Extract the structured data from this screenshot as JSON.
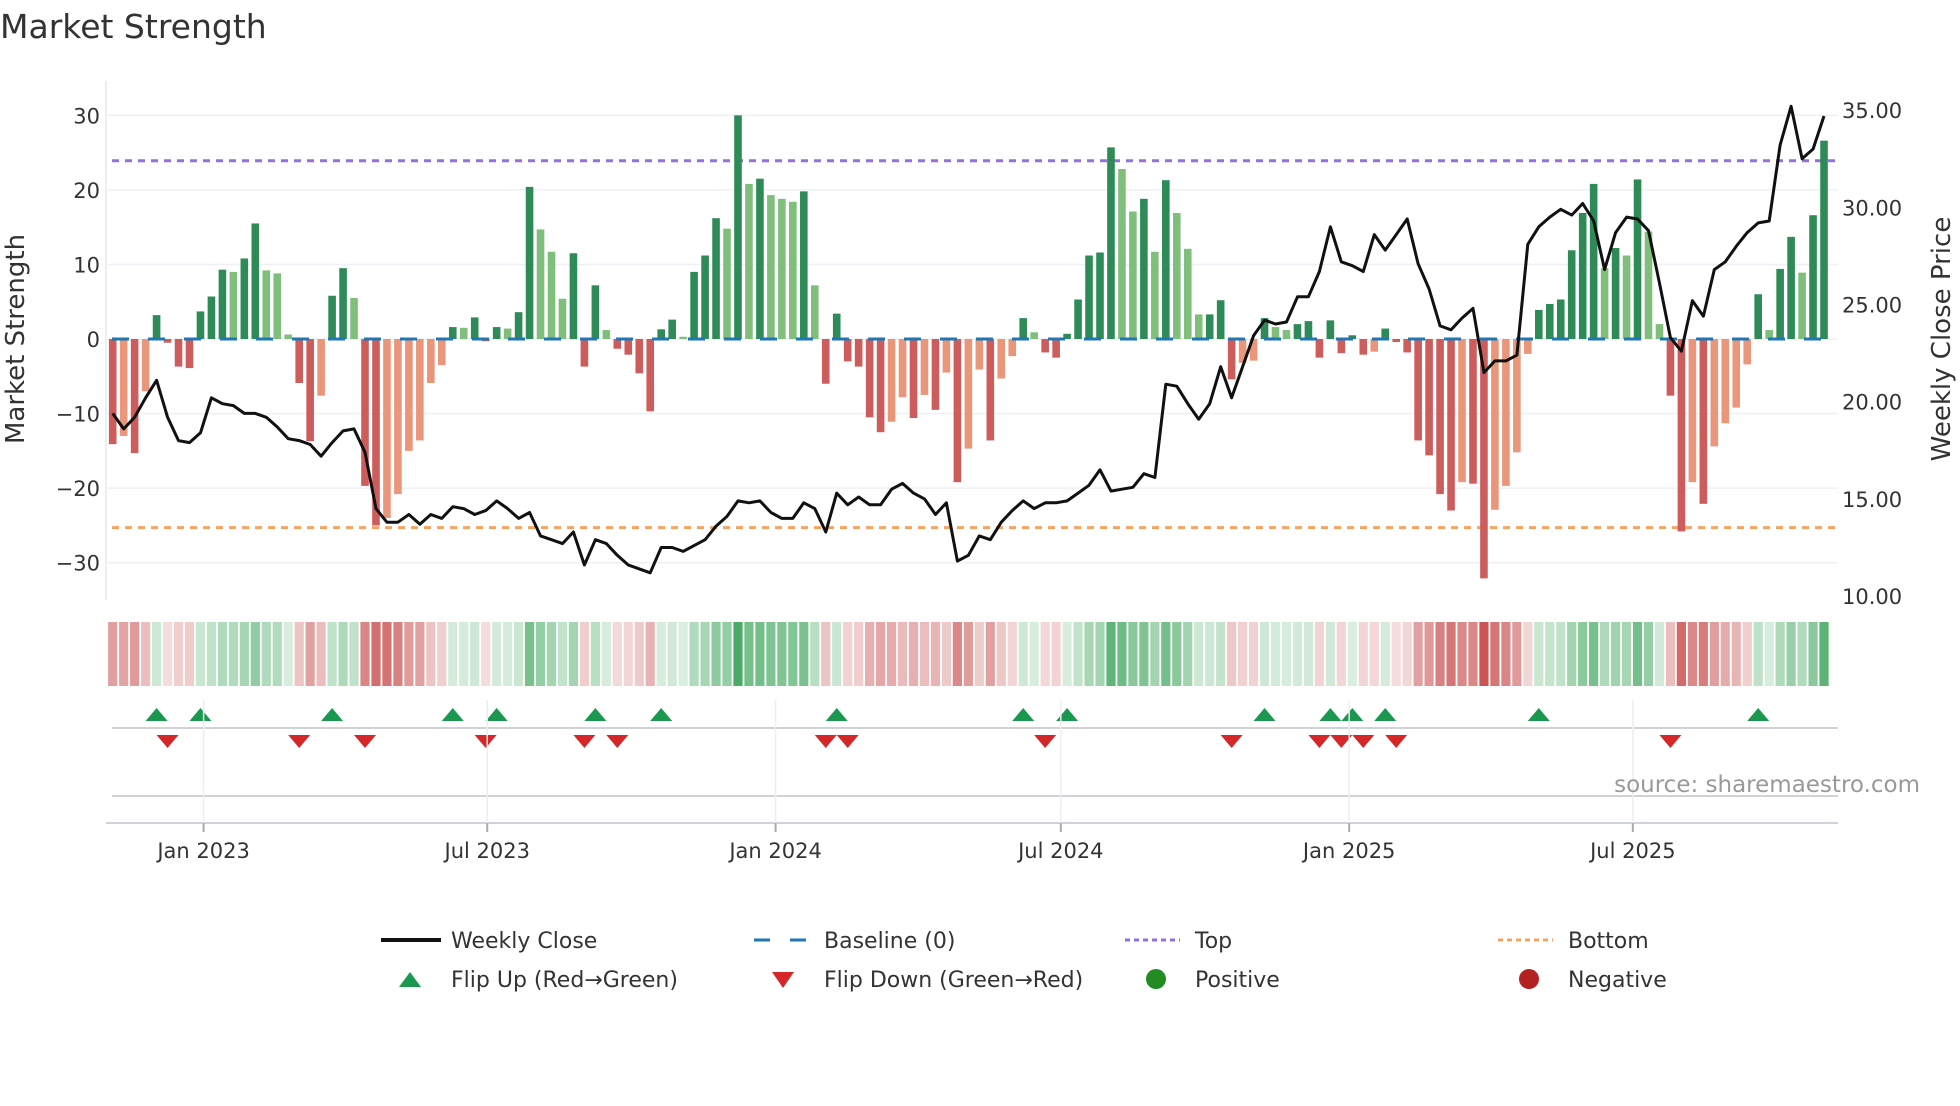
{
  "chart_data": {
    "type": "bar",
    "title": "Market Strength",
    "ylabel": "Market Strength",
    "y2label": "Weekly Close Price",
    "ylim": [
      -35,
      34.6
    ],
    "y2lim": [
      9.8,
      36.5
    ],
    "yticks": [
      30,
      20,
      10,
      0,
      -10,
      -20,
      -30
    ],
    "yticklabels": [
      "30",
      "20",
      "10",
      "0",
      "−10",
      "−20",
      "−30"
    ],
    "y2ticks": [
      35,
      30,
      25,
      20,
      15,
      10
    ],
    "y2ticklabels": [
      "35.00",
      "30.00",
      "25.00",
      "20.00",
      "15.00",
      "10.00"
    ],
    "x_start": "2022-11-04",
    "x_step_days": 7,
    "xticks": [
      {
        "date": "2023-01-01",
        "label": "Jan 2023"
      },
      {
        "date": "2023-07-01",
        "label": "Jul 2023"
      },
      {
        "date": "2024-01-01",
        "label": "Jan 2024"
      },
      {
        "date": "2024-07-01",
        "label": "Jul 2024"
      },
      {
        "date": "2025-01-01",
        "label": "Jan 2025"
      },
      {
        "date": "2025-07-01",
        "label": "Jul 2025"
      }
    ],
    "grid": true,
    "top_level": 23.9,
    "bottom_level": -25.3,
    "baseline": 0,
    "series": [
      {
        "name": "Market Strength",
        "type": "bar",
        "values": [
          -14.1,
          -13,
          -15.3,
          -7,
          3.2,
          -0.5,
          -3.7,
          -3.9,
          3.7,
          5.7,
          9.3,
          9.0,
          10.8,
          15.5,
          9.2,
          8.8,
          0.6,
          -5.9,
          -13.7,
          -7.6,
          5.8,
          9.5,
          5.5,
          -19.7,
          -25,
          -24,
          -20.8,
          -15,
          -13.6,
          -5.9,
          -3.5,
          1.6,
          1.5,
          2.9,
          -0.3,
          1.6,
          1.4,
          3.6,
          20.4,
          14.7,
          11.7,
          5.4,
          11.5,
          -3.7,
          7.2,
          1.2,
          -1.3,
          -2.1,
          -4.6,
          -9.7,
          1.3,
          2.6,
          0.3,
          9.0,
          11.2,
          16.2,
          14.8,
          30,
          20.8,
          21.5,
          19.3,
          18.8,
          18.4,
          19.8,
          7.2,
          -6.0,
          3.4,
          -3.0,
          -3.7,
          -10.5,
          -12.5,
          -11.1,
          -7.8,
          -10.6,
          -7.5,
          -9.5,
          -4.5,
          -19.2,
          -14.7,
          -4.1,
          -13.6,
          -5.3,
          -2.3,
          2.8,
          0.9,
          -1.8,
          -2.5,
          0.7,
          5.3,
          11.2,
          11.6,
          25.7,
          22.8,
          17.1,
          18.8,
          11.7,
          21.3,
          16.9,
          12.1,
          3.3,
          3.3,
          5.2,
          -5.4,
          -3.2,
          -2.9,
          2.8,
          1.6,
          1.2,
          2.0,
          2.4,
          -2.5,
          2.5,
          -1.9,
          0.5,
          -2.1,
          -1.7,
          1.4,
          -0.4,
          -1.8,
          -13.6,
          -15.6,
          -20.8,
          -23,
          -19.2,
          -19.4,
          -32.1,
          -22.9,
          -19.7,
          -15.2,
          -2.0,
          3.9,
          4.7,
          5.3,
          11.9,
          16.9,
          20.8,
          9.5,
          12.2,
          11.2,
          21.4,
          14.4,
          2.0,
          -7.6,
          -25.8,
          -19.2,
          -22.1,
          -14.4,
          -11.3,
          -9.2,
          -3.4,
          6.0,
          1.2,
          9.4,
          13.7,
          8.9,
          16.6,
          26.6
        ]
      },
      {
        "name": "Weekly Close",
        "type": "line",
        "axis": "right",
        "values": [
          19.4,
          18.6,
          19.2,
          20.2,
          21.1,
          19.2,
          18.0,
          17.9,
          18.4,
          20.2,
          19.9,
          19.8,
          19.4,
          19.4,
          19.2,
          18.7,
          18.1,
          18.0,
          17.8,
          17.2,
          17.9,
          18.5,
          18.6,
          17.4,
          14.5,
          13.8,
          13.8,
          14.2,
          13.7,
          14.2,
          14.0,
          14.6,
          14.5,
          14.2,
          14.4,
          14.9,
          14.5,
          14.0,
          14.3,
          13.1,
          12.9,
          12.7,
          13.3,
          11.6,
          12.9,
          12.7,
          12.1,
          11.6,
          11.4,
          11.2,
          12.5,
          12.5,
          12.3,
          12.6,
          12.9,
          13.6,
          14.1,
          14.9,
          14.8,
          14.9,
          14.3,
          14.0,
          14.0,
          14.8,
          14.5,
          13.3,
          15.3,
          14.7,
          15.1,
          14.7,
          14.7,
          15.5,
          15.8,
          15.3,
          15.0,
          14.2,
          14.8,
          11.8,
          12.1,
          13.1,
          12.9,
          13.8,
          14.4,
          14.9,
          14.5,
          14.8,
          14.8,
          14.9,
          15.3,
          15.7,
          16.5,
          15.4,
          15.5,
          15.6,
          16.3,
          16.1,
          20.9,
          20.8,
          19.9,
          19.1,
          19.9,
          21.8,
          20.2,
          21.8,
          23.4,
          24.2,
          24.0,
          24.1,
          25.4,
          25.4,
          26.7,
          29.0,
          27.2,
          27.0,
          26.7,
          28.6,
          27.8,
          28.6,
          29.4,
          27.1,
          25.8,
          23.9,
          23.7,
          24.3,
          24.8,
          21.5,
          22.1,
          22.1,
          22.4,
          28.1,
          29.0,
          29.5,
          29.9,
          29.6,
          30.2,
          29.3,
          26.8,
          28.7,
          29.5,
          29.4,
          28.8,
          26.1,
          23.3,
          22.6,
          25.2,
          24.4,
          26.8,
          27.2,
          28.0,
          28.7,
          29.2,
          29.3,
          33.2,
          35.2,
          32.5,
          33.0,
          34.7
        ]
      }
    ],
    "legend": {
      "placement": "bottom",
      "items": [
        {
          "label": "Weekly Close",
          "kind": "line"
        },
        {
          "label": "Baseline (0)",
          "kind": "dash"
        },
        {
          "label": "Top",
          "kind": "dot-purple"
        },
        {
          "label": "Bottom",
          "kind": "dot-orange"
        },
        {
          "label": "Flip Up (Red→Green)",
          "kind": "tri-up"
        },
        {
          "label": "Flip Down (Green→Red)",
          "kind": "tri-down"
        },
        {
          "label": "Positive",
          "kind": "circle-green"
        },
        {
          "label": "Negative",
          "kind": "circle-red"
        }
      ]
    },
    "annotation": "source: sharemaestro.com"
  },
  "colors": {
    "pos_strong": "#2e8b57",
    "pos_weak": "#7fbf7b",
    "neg_strong": "#cd5c5c",
    "neg_weak": "#e9967a",
    "top": "#9370db",
    "bottom": "#f4a460",
    "baseline": "#1f77b4",
    "flip_up": "#1a9850",
    "flip_down": "#d62728",
    "positive": "#228b22",
    "negative": "#b22222",
    "line": "#111111"
  }
}
